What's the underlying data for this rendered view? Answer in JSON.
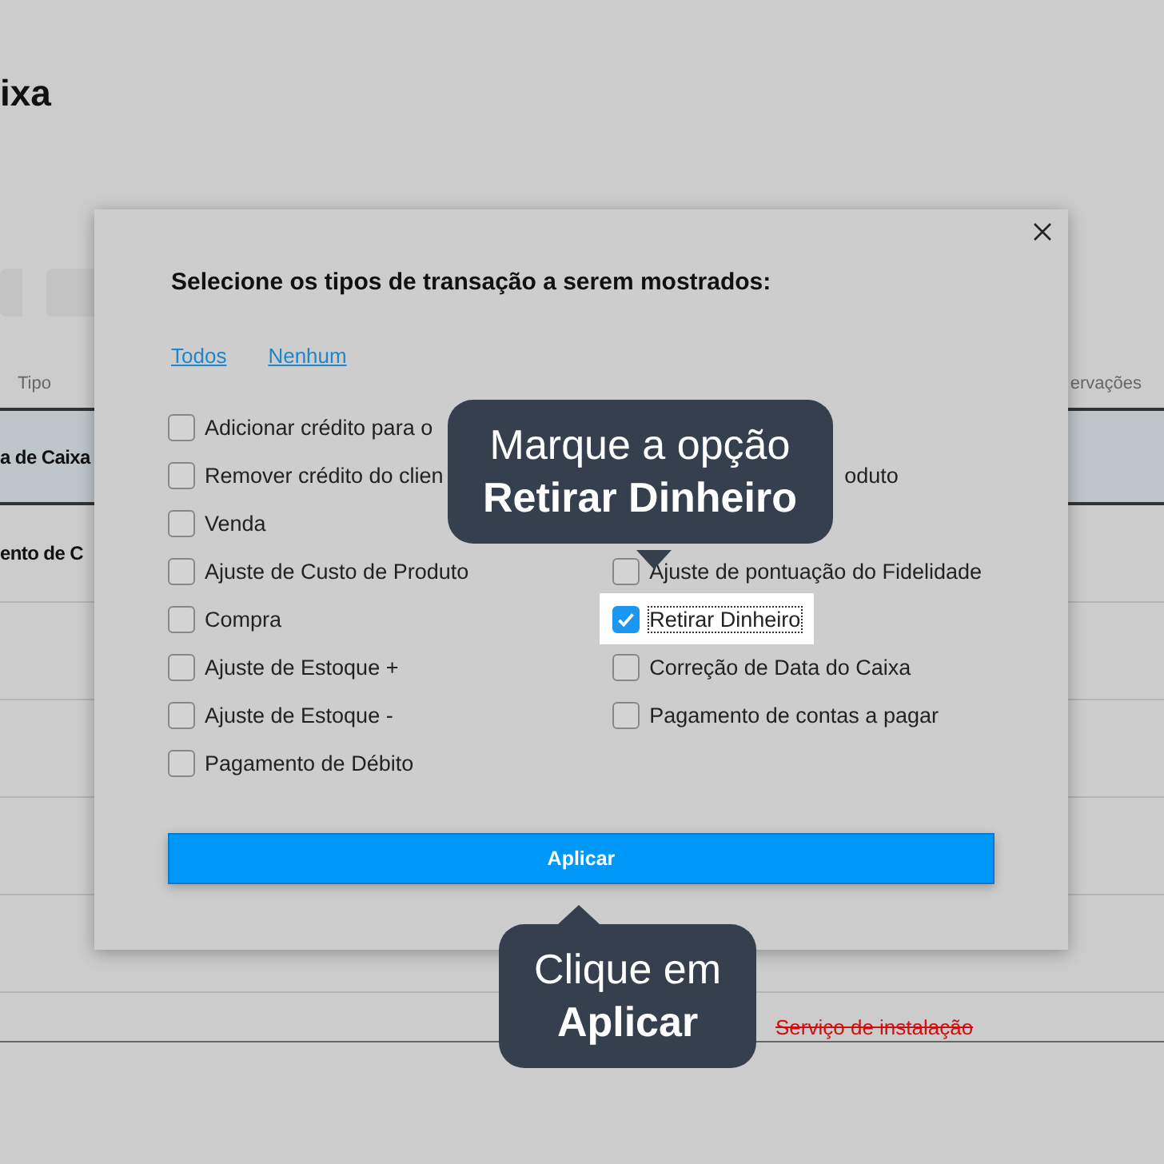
{
  "page": {
    "title": "ixa",
    "columns": [
      "Tipo",
      "ervações"
    ],
    "rows": [
      {
        "cell": "a de Caixa",
        "selected": true
      },
      {
        "cell": "ento de C",
        "selected": false
      }
    ],
    "struck_note": "Serviço de instalação"
  },
  "dialog": {
    "title": "Selecione os tipos de transação a serem mostrados:",
    "links": [
      "Todos",
      "Nenhum"
    ],
    "left": [
      {
        "label": "Adicionar crédito para o",
        "checked": false
      },
      {
        "label": "Remover crédito do clien",
        "checked": false
      },
      {
        "label": "Venda",
        "checked": false
      },
      {
        "label": "Ajuste de Custo de Produto",
        "checked": false
      },
      {
        "label": "Compra",
        "checked": false
      },
      {
        "label": "Ajuste de Estoque +",
        "checked": false
      },
      {
        "label": "Ajuste de Estoque  -",
        "checked": false
      },
      {
        "label": "Pagamento de Débito",
        "checked": false
      }
    ],
    "right": [
      {
        "kind": "fragment",
        "label": "oduto"
      },
      {
        "kind": "option",
        "label": "Ajuste de pontuação do Fidelidade",
        "checked": false
      },
      {
        "kind": "option",
        "label": "Retirar Dinheiro",
        "checked": true
      },
      {
        "kind": "option",
        "label": "Correção de Data do Caixa",
        "checked": false
      },
      {
        "kind": "option",
        "label": "Pagamento de contas a pagar",
        "checked": false
      }
    ],
    "button": "Aplicar"
  },
  "tips": [
    {
      "kind": "below",
      "line1": "Marque a opção",
      "line2": "Retirar Dinheiro"
    },
    {
      "kind": "above",
      "line1": "Clique em",
      "line2": "Aplicar"
    }
  ]
}
